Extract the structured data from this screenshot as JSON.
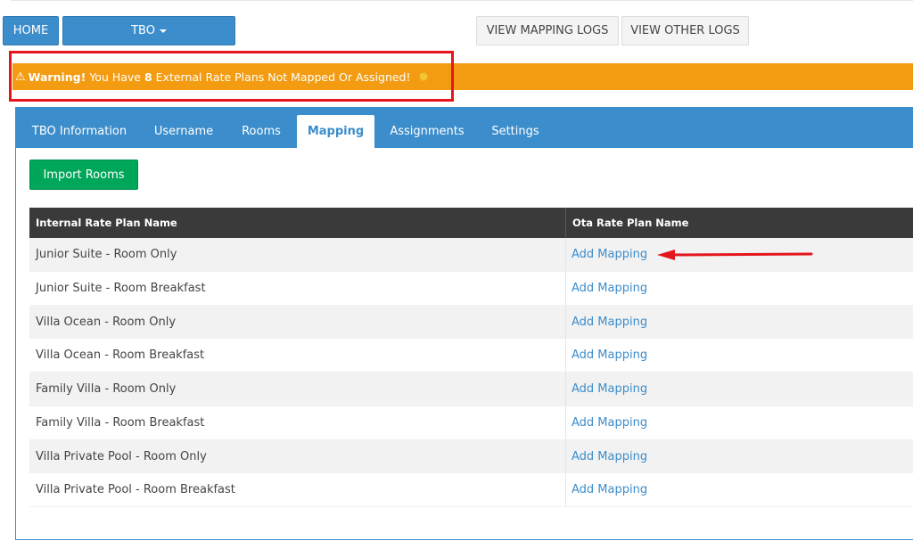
{
  "nav": {
    "home_label": "HOME",
    "channel_label": "TBO"
  },
  "logs": {
    "mapping_logs_label": "VIEW MAPPING LOGS",
    "other_logs_label": "VIEW OTHER LOGS"
  },
  "warning": {
    "bold_prefix": "Warning!",
    "text_before_count": "You Have",
    "count": "8",
    "text_after_count": "External Rate Plans Not Mapped Or Assigned!"
  },
  "tabs": [
    {
      "label": "TBO Information"
    },
    {
      "label": "Username"
    },
    {
      "label": "Rooms"
    },
    {
      "label": "Mapping",
      "active": true
    },
    {
      "label": "Assignments"
    },
    {
      "label": "Settings"
    }
  ],
  "import_button_label": "Import Rooms",
  "table": {
    "headers": [
      "Internal Rate Plan Name",
      "Ota Rate Plan Name"
    ],
    "rows": [
      {
        "internal": "Junior Suite - Room Only",
        "ota": "Add Mapping"
      },
      {
        "internal": "Junior Suite - Room Breakfast",
        "ota": "Add Mapping"
      },
      {
        "internal": "Villa Ocean - Room Only",
        "ota": "Add Mapping"
      },
      {
        "internal": "Villa Ocean - Room Breakfast",
        "ota": "Add Mapping"
      },
      {
        "internal": "Family Villa - Room Only",
        "ota": "Add Mapping"
      },
      {
        "internal": "Family Villa - Room Breakfast",
        "ota": "Add Mapping"
      },
      {
        "internal": "Villa Private Pool - Room Only",
        "ota": "Add Mapping"
      },
      {
        "internal": "Villa Private Pool - Room Breakfast",
        "ota": "Add Mapping"
      }
    ]
  },
  "colors": {
    "primary": "#3c8dcb",
    "success": "#00a65a",
    "warning": "#f39c12",
    "highlight_red": "#e4151c",
    "table_header": "#3a3a3a"
  },
  "icons": {
    "warning": "warning-triangle-icon",
    "dropdown": "caret-down-icon",
    "annotation": "red-arrow-annotation"
  }
}
